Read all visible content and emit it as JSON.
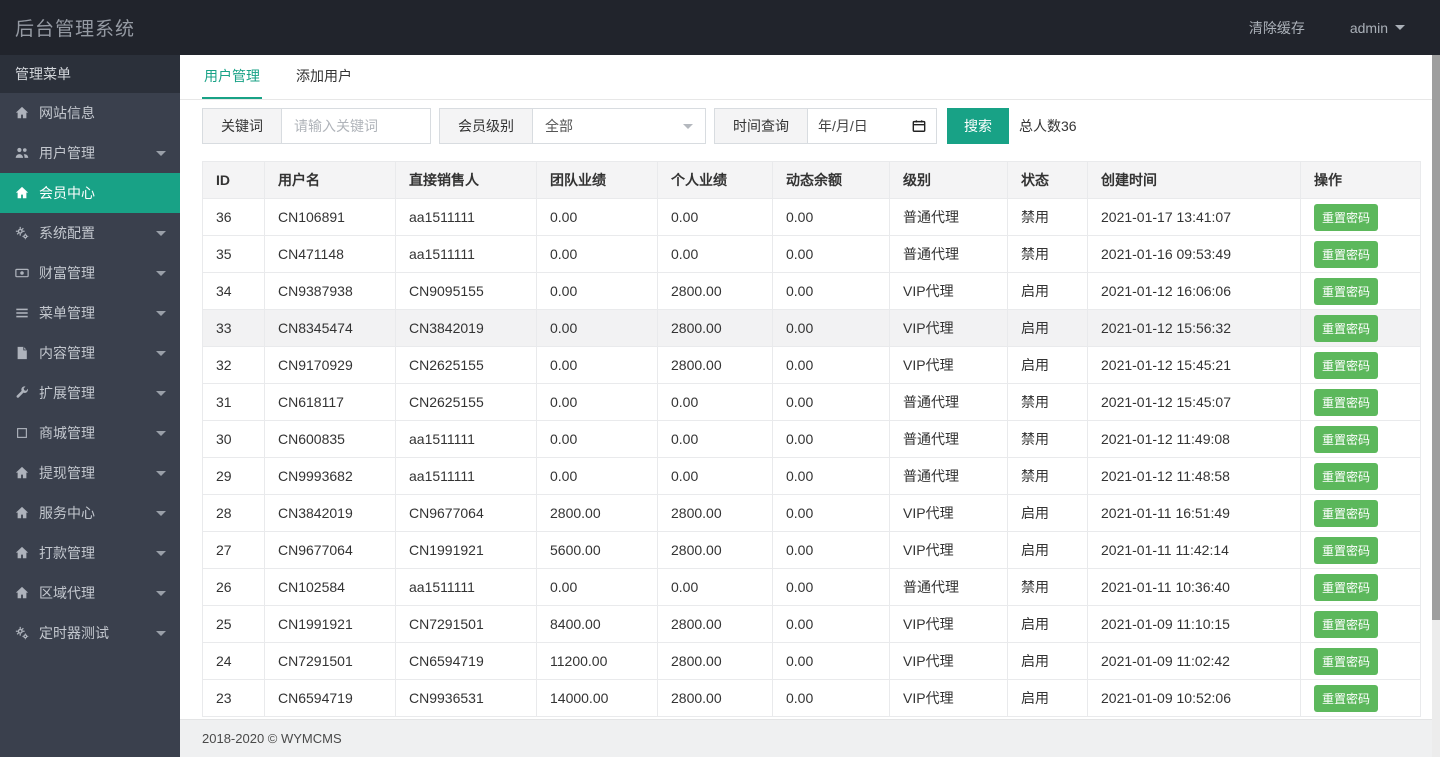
{
  "topbar": {
    "brand": "后台管理系统",
    "clear_cache": "清除缓存",
    "user": "admin"
  },
  "sidebar": {
    "header": "管理菜单",
    "items": [
      {
        "key": "site-info",
        "icon": "home",
        "label": "网站信息",
        "caret": false,
        "active": false
      },
      {
        "key": "user-mgmt",
        "icon": "users",
        "label": "用户管理",
        "caret": true,
        "active": false
      },
      {
        "key": "member-center",
        "icon": "home",
        "label": "会员中心",
        "caret": false,
        "active": true
      },
      {
        "key": "system-config",
        "icon": "cogs",
        "label": "系统配置",
        "caret": true,
        "active": false
      },
      {
        "key": "wealth-mgmt",
        "icon": "money",
        "label": "财富管理",
        "caret": true,
        "active": false
      },
      {
        "key": "menu-mgmt",
        "icon": "list",
        "label": "菜单管理",
        "caret": true,
        "active": false
      },
      {
        "key": "content-mgmt",
        "icon": "file",
        "label": "内容管理",
        "caret": true,
        "active": false
      },
      {
        "key": "extension-mgmt",
        "icon": "wrench",
        "label": "扩展管理",
        "caret": true,
        "active": false
      },
      {
        "key": "mall-mgmt",
        "icon": "box",
        "label": "商城管理",
        "caret": true,
        "active": false
      },
      {
        "key": "withdraw-mgmt",
        "icon": "home",
        "label": "提现管理",
        "caret": true,
        "active": false
      },
      {
        "key": "service-center",
        "icon": "home",
        "label": "服务中心",
        "caret": true,
        "active": false
      },
      {
        "key": "payment-mgmt",
        "icon": "home",
        "label": "打款管理",
        "caret": true,
        "active": false
      },
      {
        "key": "region-agent",
        "icon": "home",
        "label": "区域代理",
        "caret": true,
        "active": false
      },
      {
        "key": "timer-test",
        "icon": "cogs",
        "label": "定时器测试",
        "caret": true,
        "active": false
      }
    ]
  },
  "tabs": [
    {
      "key": "user-management",
      "label": "用户管理",
      "active": true
    },
    {
      "key": "add-user",
      "label": "添加用户",
      "active": false
    }
  ],
  "filters": {
    "keyword_label": "关键词",
    "keyword_placeholder": "请输入关键词",
    "level_label": "会员级别",
    "level_value": "全部",
    "time_label": "时间查询",
    "date_value": "年/月/日",
    "search_button": "搜索",
    "total_text": "总人数36"
  },
  "table": {
    "columns": [
      "ID",
      "用户名",
      "直接销售人",
      "团队业绩",
      "个人业绩",
      "动态余额",
      "级别",
      "状态",
      "创建时间",
      "操作"
    ],
    "action_label": "重置密码",
    "rows": [
      {
        "id": "36",
        "username": "CN106891",
        "referrer": "aa1511111",
        "team": "0.00",
        "personal": "0.00",
        "balance": "0.00",
        "level": "普通代理",
        "status": "禁用",
        "created": "2021-01-17 13:41:07",
        "highlight": false
      },
      {
        "id": "35",
        "username": "CN471148",
        "referrer": "aa1511111",
        "team": "0.00",
        "personal": "0.00",
        "balance": "0.00",
        "level": "普通代理",
        "status": "禁用",
        "created": "2021-01-16 09:53:49",
        "highlight": false
      },
      {
        "id": "34",
        "username": "CN9387938",
        "referrer": "CN9095155",
        "team": "0.00",
        "personal": "2800.00",
        "balance": "0.00",
        "level": "VIP代理",
        "status": "启用",
        "created": "2021-01-12 16:06:06",
        "highlight": false
      },
      {
        "id": "33",
        "username": "CN8345474",
        "referrer": "CN3842019",
        "team": "0.00",
        "personal": "2800.00",
        "balance": "0.00",
        "level": "VIP代理",
        "status": "启用",
        "created": "2021-01-12 15:56:32",
        "highlight": true
      },
      {
        "id": "32",
        "username": "CN9170929",
        "referrer": "CN2625155",
        "team": "0.00",
        "personal": "2800.00",
        "balance": "0.00",
        "level": "VIP代理",
        "status": "启用",
        "created": "2021-01-12 15:45:21",
        "highlight": false
      },
      {
        "id": "31",
        "username": "CN618117",
        "referrer": "CN2625155",
        "team": "0.00",
        "personal": "0.00",
        "balance": "0.00",
        "level": "普通代理",
        "status": "禁用",
        "created": "2021-01-12 15:45:07",
        "highlight": false
      },
      {
        "id": "30",
        "username": "CN600835",
        "referrer": "aa1511111",
        "team": "0.00",
        "personal": "0.00",
        "balance": "0.00",
        "level": "普通代理",
        "status": "禁用",
        "created": "2021-01-12 11:49:08",
        "highlight": false
      },
      {
        "id": "29",
        "username": "CN9993682",
        "referrer": "aa1511111",
        "team": "0.00",
        "personal": "0.00",
        "balance": "0.00",
        "level": "普通代理",
        "status": "禁用",
        "created": "2021-01-12 11:48:58",
        "highlight": false
      },
      {
        "id": "28",
        "username": "CN3842019",
        "referrer": "CN9677064",
        "team": "2800.00",
        "personal": "2800.00",
        "balance": "0.00",
        "level": "VIP代理",
        "status": "启用",
        "created": "2021-01-11 16:51:49",
        "highlight": false
      },
      {
        "id": "27",
        "username": "CN9677064",
        "referrer": "CN1991921",
        "team": "5600.00",
        "personal": "2800.00",
        "balance": "0.00",
        "level": "VIP代理",
        "status": "启用",
        "created": "2021-01-11 11:42:14",
        "highlight": false
      },
      {
        "id": "26",
        "username": "CN102584",
        "referrer": "aa1511111",
        "team": "0.00",
        "personal": "0.00",
        "balance": "0.00",
        "level": "普通代理",
        "status": "禁用",
        "created": "2021-01-11 10:36:40",
        "highlight": false
      },
      {
        "id": "25",
        "username": "CN1991921",
        "referrer": "CN7291501",
        "team": "8400.00",
        "personal": "2800.00",
        "balance": "0.00",
        "level": "VIP代理",
        "status": "启用",
        "created": "2021-01-09 11:10:15",
        "highlight": false
      },
      {
        "id": "24",
        "username": "CN7291501",
        "referrer": "CN6594719",
        "team": "11200.00",
        "personal": "2800.00",
        "balance": "0.00",
        "level": "VIP代理",
        "status": "启用",
        "created": "2021-01-09 11:02:42",
        "highlight": false
      },
      {
        "id": "23",
        "username": "CN6594719",
        "referrer": "CN9936531",
        "team": "14000.00",
        "personal": "2800.00",
        "balance": "0.00",
        "level": "VIP代理",
        "status": "启用",
        "created": "2021-01-09 10:52:06",
        "highlight": false
      }
    ]
  },
  "footer": {
    "copyright": "2018-2020 © WYMCMS"
  },
  "colors": {
    "accent_teal": "#18a286",
    "button_green": "#5cb85c",
    "topbar_bg": "#21242c",
    "sidebar_bg": "#3a404d"
  }
}
